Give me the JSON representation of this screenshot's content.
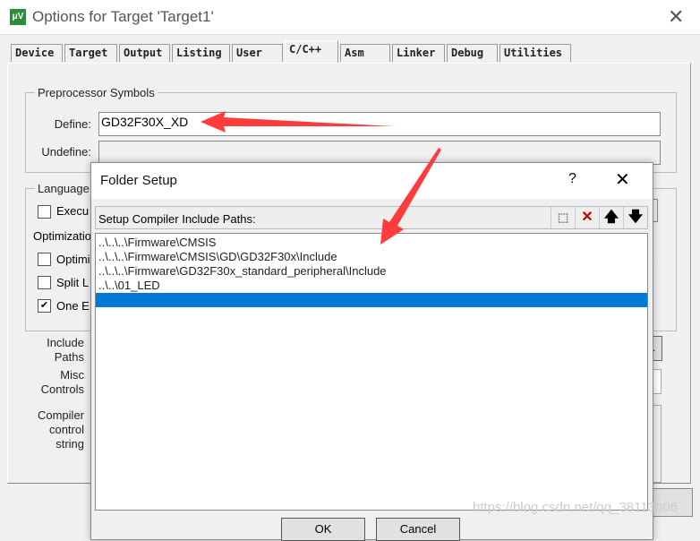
{
  "window": {
    "title": "Options for Target 'Target1'",
    "icon": "keil-uvision-icon",
    "close": "✕"
  },
  "tabs": [
    "Device",
    "Target",
    "Output",
    "Listing",
    "User",
    "C/C++",
    "Asm",
    "Linker",
    "Debug",
    "Utilities"
  ],
  "active_tab": "C/C++",
  "preprocessor": {
    "group_label": "Preprocessor Symbols",
    "define_label": "Define:",
    "define_value": "GD32F30X_XD",
    "undefine_label": "Undefine:",
    "undefine_value": ""
  },
  "language": {
    "group_label": "Language",
    "execute_only": "Execu",
    "optimization_label": "Optimizatio",
    "optimize": "Optimi",
    "split": "Split L",
    "one_elf": "One E",
    "right_fragment": "s"
  },
  "side_labels": {
    "include_paths": [
      "Include",
      "Paths"
    ],
    "misc": [
      "Misc",
      "Controls"
    ],
    "compiler": [
      "Compiler",
      "control",
      "string"
    ]
  },
  "browse_fragment": "...",
  "dialog": {
    "title": "Folder Setup",
    "help": "?",
    "close": "✕",
    "header": "Setup Compiler Include Paths:",
    "toolbar": [
      {
        "icon": "new-folder-icon",
        "glyph": "⬚"
      },
      {
        "icon": "delete-icon",
        "glyph": "✕"
      },
      {
        "icon": "move-up-icon",
        "glyph": "🡅"
      },
      {
        "icon": "move-down-icon",
        "glyph": "🡇"
      }
    ],
    "paths": [
      "..\\..\\..\\Firmware\\CMSIS",
      "..\\..\\..\\Firmware\\CMSIS\\GD\\GD32F30x\\Include",
      "..\\..\\..\\Firmware\\GD32F30x_standard_peripheral\\Include",
      "..\\..\\01_LED",
      ""
    ],
    "selected_index": 4,
    "ok": "OK",
    "cancel": "Cancel"
  },
  "colors": {
    "selection": "#0078d7",
    "arrow": "#ff3b3b"
  },
  "watermark": "https://blog.csdn.net/qq_38113006"
}
